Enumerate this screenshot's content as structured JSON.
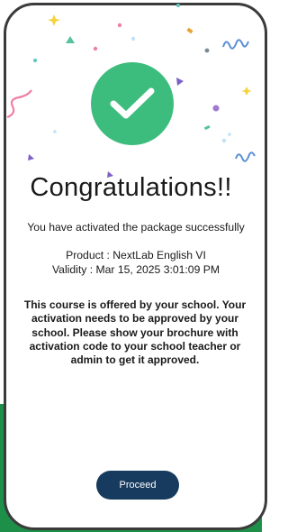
{
  "colors": {
    "success_green": "#3dbd7d",
    "button_navy": "#173b5e",
    "background_green": "#1e8f49",
    "phone_frame": "#3b3b3b"
  },
  "icons": {
    "success": "checkmark-icon",
    "decoration": "confetti"
  },
  "dialog": {
    "title": "Congratulations!!",
    "subtitle": "You have activated the package successfully",
    "product_line": "Product : NextLab English VI",
    "validity_line": "Validity : Mar 15, 2025 3:01:09 PM",
    "notice": "This course is offered by your school. Your activation needs to be approved by your school. Please show your brochure with activation code to your school teacher or admin to get it approved.",
    "proceed_label": "Proceed"
  }
}
